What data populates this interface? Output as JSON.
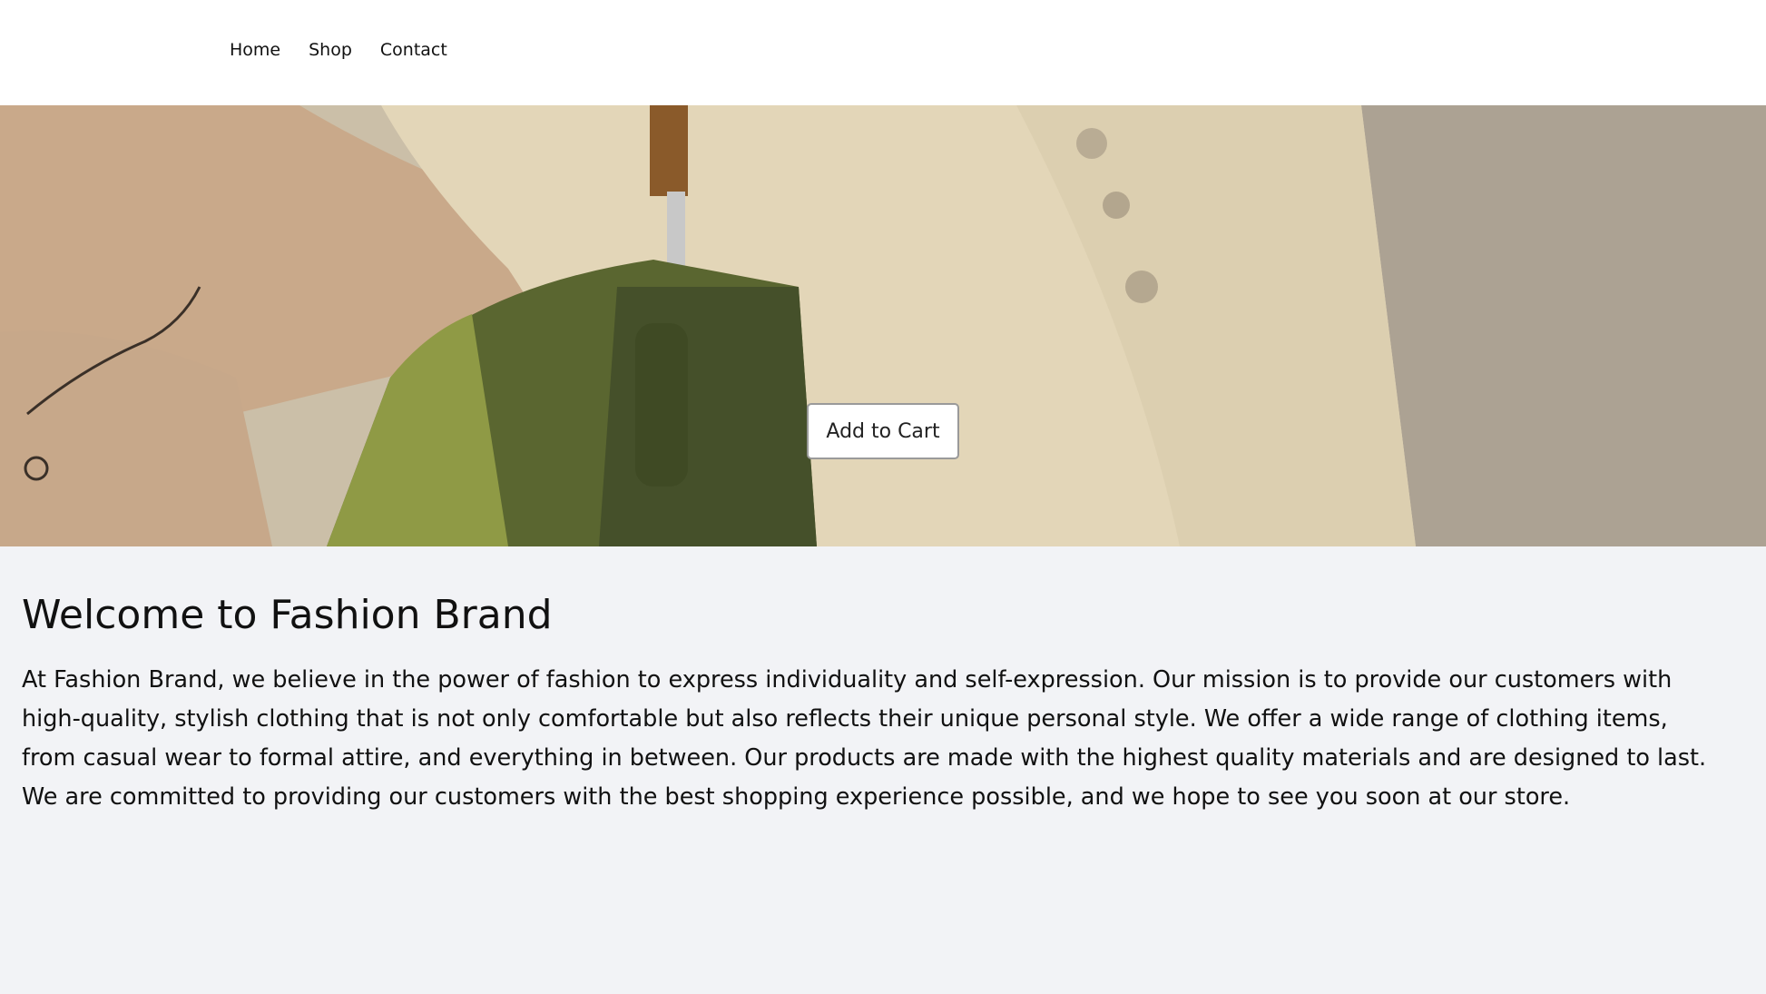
{
  "nav": {
    "items": [
      "Home",
      "Shop",
      "Contact"
    ]
  },
  "hero": {
    "image_subject": "woman in cream ribbed henley top carrying olive green leather bag",
    "cart_button_label": "Add to Cart"
  },
  "main": {
    "title": "Welcome to Fashion Brand",
    "description": "At Fashion Brand, we believe in the power of fashion to express individuality and self-expression. Our mission is to provide our customers with high-quality, stylish clothing that is not only comfortable but also reflects their unique personal style. We offer a wide range of clothing items, from casual wear to formal attire, and everything in between. Our products are made with the highest quality materials and are designed to last. We are committed to providing our customers with the best shopping experience possible, and we hope to see you soon at our store."
  },
  "colors": {
    "page_background": "#f2f3f6",
    "header_background": "#ffffff",
    "text": "#111111",
    "bag_green": "#4f5a2c",
    "top_cream": "#e3d6b8"
  }
}
